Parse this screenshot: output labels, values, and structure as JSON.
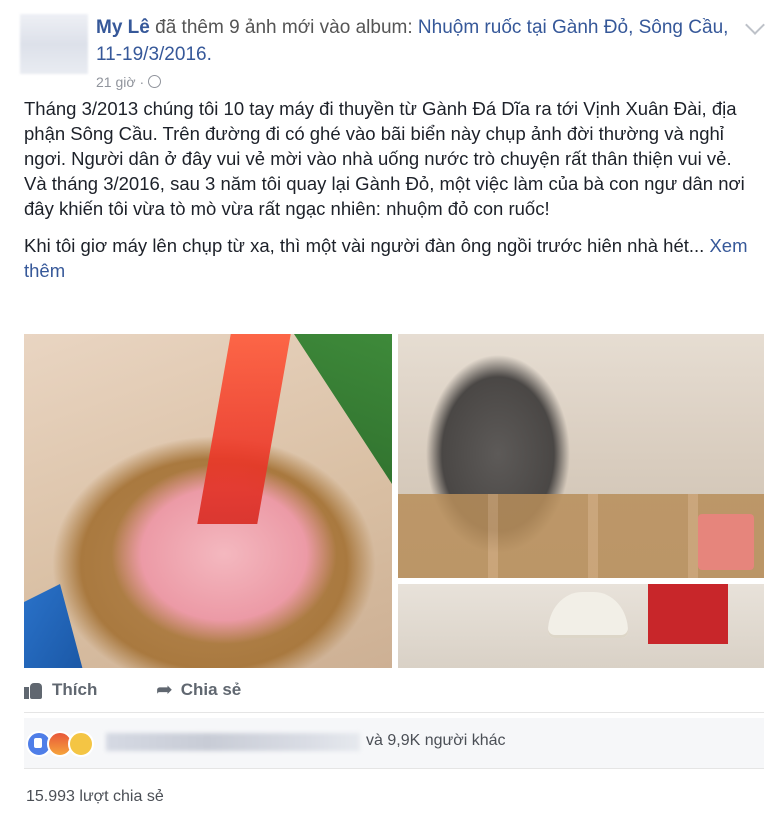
{
  "post": {
    "author": "My Lê",
    "action_text": "đã thêm 9 ảnh mới vào album:",
    "album": "Nhuộm ruốc tại Gành Đỏ, Sông Cầu, 11-19/3/2016.",
    "time": "21 giờ",
    "separator": "·",
    "paragraph1": "Tháng 3/2013 chúng tôi 10 tay máy đi thuyền từ Gành Đá Dĩa ra tới Vịnh Xuân Đài, địa phận Sông Cầu. Trên đường đi có ghé vào bãi biển này chụp ảnh đời thường và nghỉ ngơi. Người dân ở đây vui vẻ mời vào nhà uống nước trò chuyện rất thân thiện vui vẻ.",
    "paragraph2": "Và tháng 3/2016, sau 3 năm tôi quay lại Gành Đỏ, một việc làm của bà con ngư dân nơi đây khiến tôi vừa tò mò vừa rất ngạc nhiên: nhuộm đỏ con ruốc!",
    "paragraph3": "Khi tôi giơ máy lên chụp từ xa, thì một vài người đàn ông ngồi trước hiên nhà hét...",
    "see_more": "Xem thêm"
  },
  "actions": {
    "like": "Thích",
    "share": "Chia sẻ",
    "like_icon": "thumbs-up-icon",
    "share_icon": "share-arrow-icon"
  },
  "reactions": {
    "icons": [
      "like",
      "angry",
      "sad"
    ],
    "others_text": "và 9,9K người khác"
  },
  "shares_text": "15.993 lượt chia sẻ",
  "colors": {
    "link": "#365899",
    "text": "#1d2129",
    "meta": "#90949c"
  }
}
